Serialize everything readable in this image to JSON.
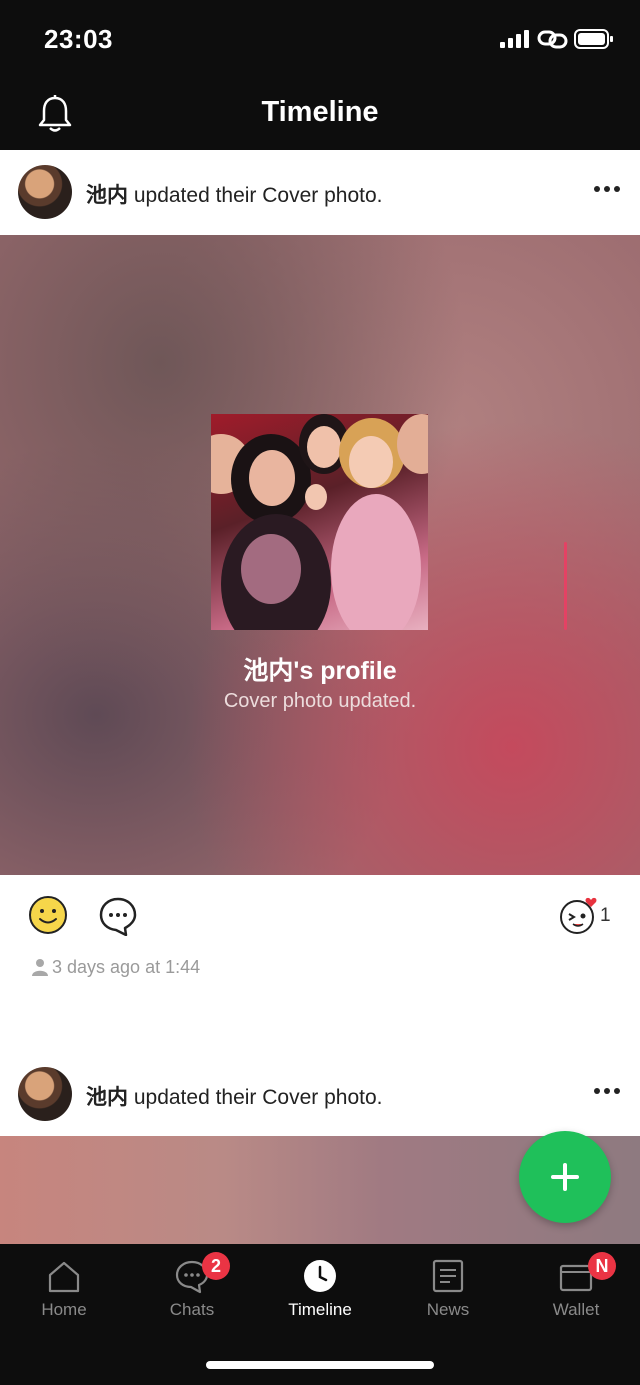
{
  "status_bar": {
    "time": "23:03"
  },
  "nav": {
    "title": "Timeline"
  },
  "posts": [
    {
      "author": "池内",
      "action": " updated their Cover photo.",
      "cover_title": "池内's profile",
      "cover_subtitle": "Cover photo updated.",
      "reaction_count": "1",
      "timestamp": "3 days ago at 1:44"
    },
    {
      "author": "池内",
      "action": " updated their Cover photo."
    }
  ],
  "tabs": [
    {
      "label": "Home",
      "icon": "home-icon"
    },
    {
      "label": "Chats",
      "icon": "chat-bubble-icon",
      "badge": "2"
    },
    {
      "label": "Timeline",
      "icon": "clock-icon",
      "active": true
    },
    {
      "label": "News",
      "icon": "news-icon"
    },
    {
      "label": "Wallet",
      "icon": "wallet-icon",
      "badge": "N"
    }
  ],
  "colors": {
    "accent_green": "#1fc05a",
    "badge_red": "#ea3444",
    "bar_black": "#0d0d0d"
  }
}
